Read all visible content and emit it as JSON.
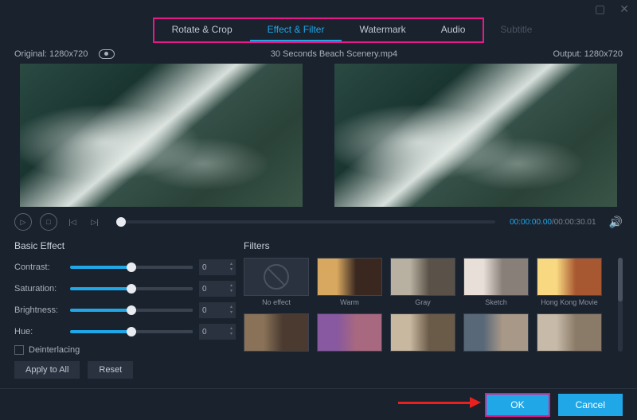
{
  "window": {
    "minimize": "▢",
    "close": "✕"
  },
  "tabs": {
    "rotate": "Rotate & Crop",
    "effect": "Effect & Filter",
    "watermark": "Watermark",
    "audio": "Audio",
    "subtitle": "Subtitle"
  },
  "info": {
    "original": "Original: 1280x720",
    "filename": "30 Seconds Beach Scenery.mp4",
    "output": "Output: 1280x720"
  },
  "playback": {
    "current": "00:00:00.00",
    "duration": "/00:00:30.01"
  },
  "basic_effect": {
    "title": "Basic Effect",
    "contrast_label": "Contrast:",
    "saturation_label": "Saturation:",
    "brightness_label": "Brightness:",
    "hue_label": "Hue:",
    "contrast_value": "0",
    "saturation_value": "0",
    "brightness_value": "0",
    "hue_value": "0",
    "deinterlacing": "Deinterlacing",
    "apply_all": "Apply to All",
    "reset": "Reset"
  },
  "filters": {
    "title": "Filters",
    "items": {
      "noeffect": "No effect",
      "warm": "Warm",
      "gray": "Gray",
      "sketch": "Sketch",
      "hk": "Hong Kong Movie"
    }
  },
  "footer": {
    "ok": "OK",
    "cancel": "Cancel"
  }
}
